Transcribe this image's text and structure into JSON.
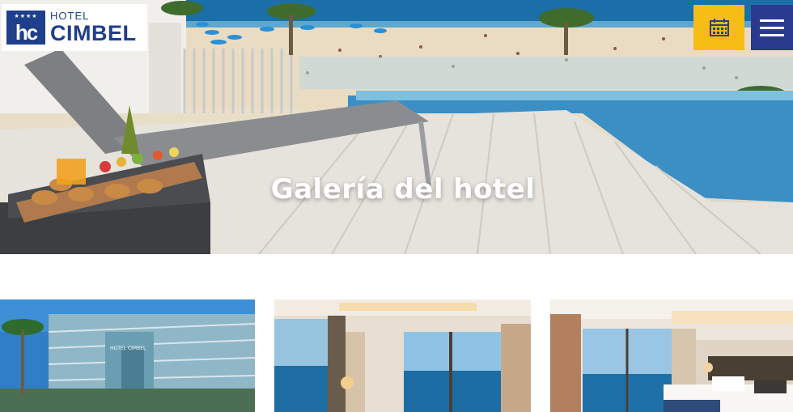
{
  "brand": {
    "hotel_label": "HOTEL",
    "name": "CIMBEL",
    "monogram": "hc",
    "stars": "★★★★",
    "color": "#1f3f8c"
  },
  "header": {
    "calendar_icon": "calendar-icon",
    "menu_icon": "hamburger-menu-icon",
    "calendar_color": "#f6bd14",
    "menu_color": "#2a3a8e"
  },
  "hero": {
    "title": "Galería del hotel"
  },
  "gallery": {
    "items": [
      {
        "subject": "hotel-exterior",
        "sign_text": "HOTEL CIMBEL"
      },
      {
        "subject": "room-sea-view"
      },
      {
        "subject": "bedroom-balcony"
      }
    ]
  }
}
